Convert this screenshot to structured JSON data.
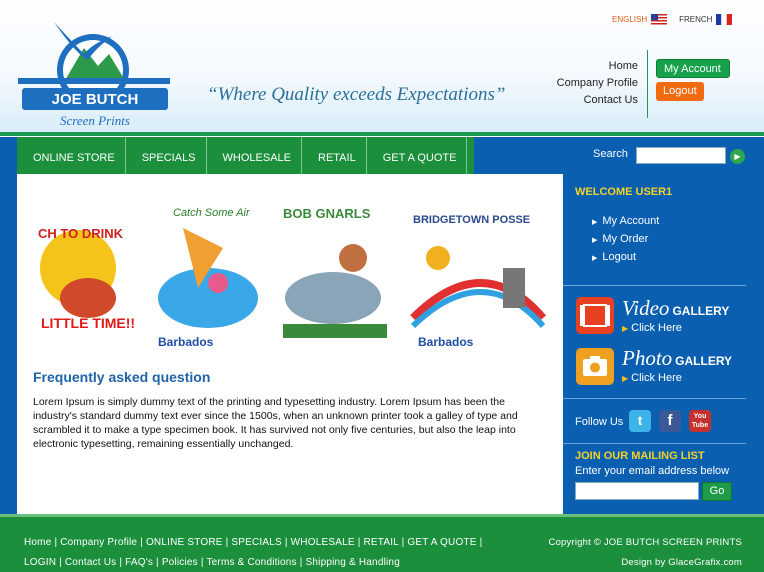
{
  "brand": {
    "name": "JOE BUTCH",
    "sub": "Screen Prints",
    "tagline": "“Where Quality exceeds Expectations”"
  },
  "languages": [
    {
      "label": "ENGLISH",
      "flag": "us-flag-icon"
    },
    {
      "label": "FRENCH",
      "flag": "fr-flag-icon"
    }
  ],
  "top_links": [
    "Home",
    "Company Profile",
    "Contact Us"
  ],
  "account": {
    "my_account": "My Account",
    "logout": "Logout"
  },
  "nav": [
    "ONLINE STORE",
    "SPECIALS",
    "WHOLESALE",
    "RETAIL",
    "GET A QUOTE"
  ],
  "search": {
    "label": "Search",
    "placeholder": ""
  },
  "banner_texts": [
    "CH TO DRINK",
    "LITTLE TIME!!",
    "Catch Some Air",
    "BOB GNARLS",
    "BRIDGETOWN POSSE",
    "Barbados",
    "Barbados"
  ],
  "faq": {
    "title": "Frequently asked question",
    "body": "Lorem Ipsum is simply dummy text of the printing and typesetting industry. Lorem Ipsum has been the industry's standard dummy text ever since the 1500s, when an unknown printer took a galley of type and scrambled it to make a type specimen book. It has survived not only five centuries, but also the leap into electronic typesetting, remaining essentially unchanged."
  },
  "sidebar": {
    "welcome": "WELCOME USER1",
    "links": [
      "My Account",
      "My Order",
      "Logout"
    ],
    "video": {
      "big": "Video",
      "small": "GALLERY",
      "click": "Click Here"
    },
    "photo": {
      "big": "Photo",
      "small": "GALLERY",
      "click": "Click Here"
    },
    "follow": "Follow Us",
    "social": [
      "t",
      "f",
      "You Tube"
    ],
    "mailing_title": "JOIN OUR MAILING LIST",
    "mailing_sub": "Enter your email address below",
    "go": "Go"
  },
  "footer": {
    "row1": [
      "Home",
      "Company Profile",
      "ONLINE STORE",
      "SPECIALS",
      "WHOLESALE",
      "RETAIL",
      "GET A QUOTE"
    ],
    "row2": [
      "LOGIN",
      "Contact Us",
      "FAQ's",
      "Policies",
      "Terms & Conditions",
      "Shipping & Handling"
    ],
    "copyright": "Copyright © JOE BUTCH SCREEN PRINTS",
    "design": "Design by GlaceGrafix.com"
  },
  "colors": {
    "green": "#1b8f3c",
    "blue": "#0a5fb0",
    "orange": "#f06a10",
    "yellow": "#f3d22a"
  }
}
